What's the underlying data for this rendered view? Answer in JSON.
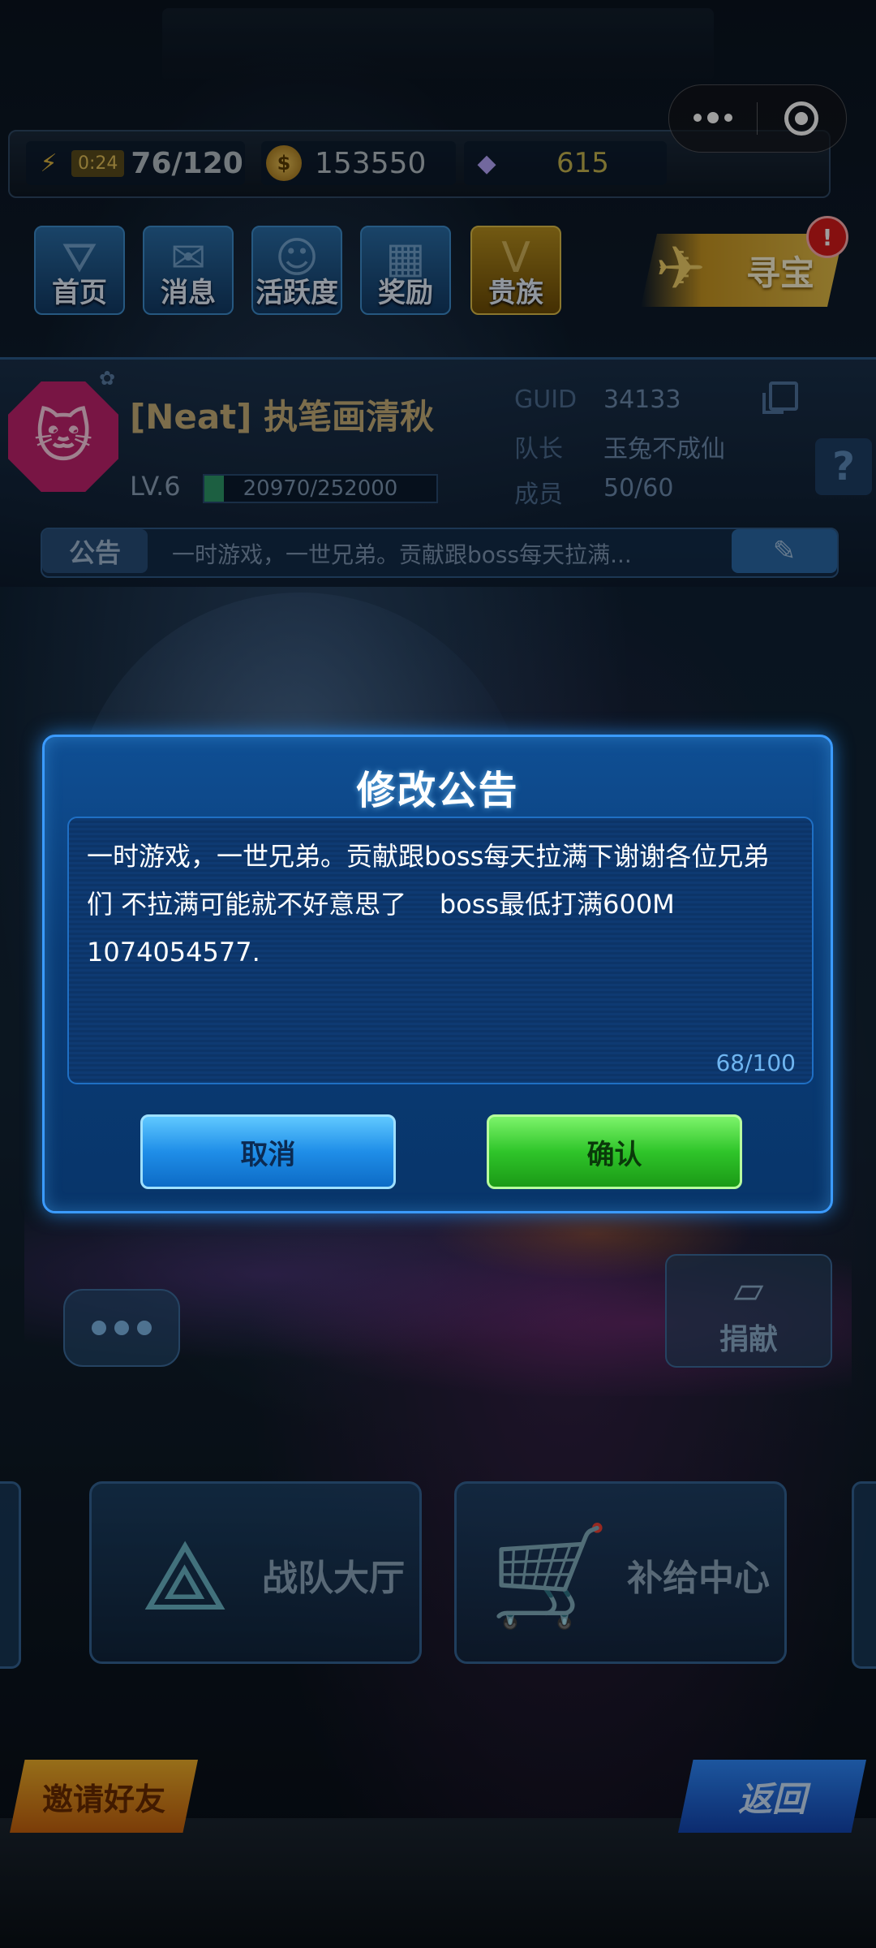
{
  "resources": {
    "energy_timer": "0:24",
    "energy_value": "76/120",
    "coins": "153550",
    "gems": "615"
  },
  "nav": [
    {
      "label": "首页",
      "icon": "home-icon"
    },
    {
      "label": "消息",
      "icon": "mail-icon"
    },
    {
      "label": "活跃度",
      "icon": "smile-wings-icon"
    },
    {
      "label": "奖励",
      "icon": "gift-icon"
    },
    {
      "label": "贵族",
      "icon": "noble-v-icon"
    }
  ],
  "treasure": {
    "label": "寻宝",
    "badge": "!"
  },
  "guild": {
    "name": "[Neat] 执笔画清秋",
    "level": "LV.6",
    "exp": "20970/252000",
    "exp_fraction": 0.083,
    "guid_label": "GUID",
    "guid_value": "34133",
    "leader_label": "队长",
    "leader_value": "玉兔不成仙",
    "members_label": "成员",
    "members_value": "50/60"
  },
  "notice": {
    "tag": "公告",
    "preview": "一时游戏，一世兄弟。贡献跟boss每天拉满..."
  },
  "donate": {
    "label": "捐献"
  },
  "halls": [
    {
      "label": "战队大厅"
    },
    {
      "label": "补给中心"
    }
  ],
  "invite": {
    "label": "邀请好友"
  },
  "back": {
    "label": "返回"
  },
  "modal": {
    "title": "修改公告",
    "text": "一时游戏，一世兄弟。贡献跟boss每天拉满下谢谢各位兄弟们 不拉满可能就不好意思了    boss最低打满600M\n1074054577.",
    "count": "68/100",
    "cancel": "取消",
    "confirm": "确认"
  },
  "colors": {
    "modal_bg": "#0a3c76",
    "modal_border": "#3b9bff",
    "cancel": "#1f8ee8",
    "confirm": "#2fc52a"
  }
}
